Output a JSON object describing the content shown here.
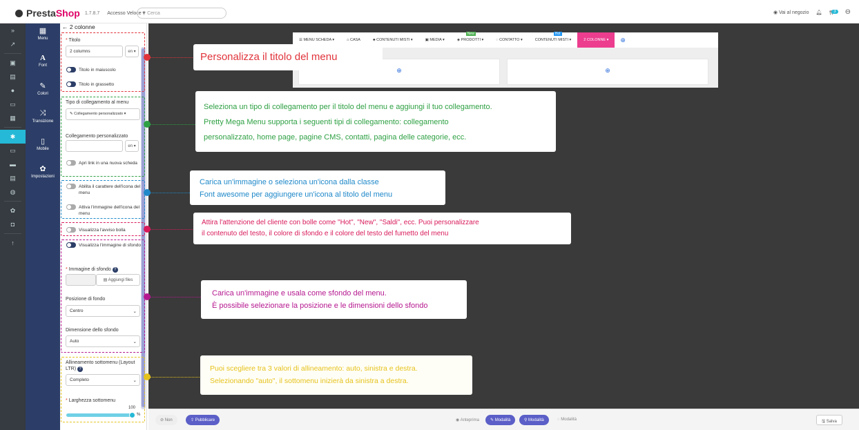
{
  "topbar": {
    "brand_prefix": "Presta",
    "brand_suffix": "Shop",
    "version": "1.7.8.7",
    "quick_access": "Accesso Veloce ▾",
    "search_placeholder": "Cerca",
    "shop_link": "Vai al negozio",
    "cart_badge": "3"
  },
  "tools": [
    {
      "icon": "▦",
      "label": "Menu"
    },
    {
      "icon": "A",
      "label": "Font"
    },
    {
      "icon": "✎",
      "label": "Colori"
    },
    {
      "icon": "⤨",
      "label": "Transizione"
    },
    {
      "icon": "▯",
      "label": "Mobile"
    },
    {
      "icon": "✿",
      "label": "Impostazioni"
    }
  ],
  "panel": {
    "back_title": "← 2 colonne",
    "title_label": "Titolo",
    "title_value": "2 columns",
    "lang": "en ▾",
    "uppercase_label": "Titolo in maiuscolo",
    "bold_label": "Titolo in grassetto",
    "link_type_label": "Tipo di collegamento al menu",
    "link_type_value": "Collegamento personalizzato ▾",
    "custom_link_label": "Collegamento personalizzato",
    "new_tab_label": "Apri link in una nuova scheda",
    "icon_char_label": "Abilita il carattere dell'icona del menu",
    "icon_image_label": "Attiva l'immagine dell'icona del menu",
    "bubble_label": "Visualizza l'avviso bolla",
    "bg_image_label": "Visualizza l'immagine di sfondo",
    "bg_image_field": "Immagine di sfondo",
    "add_files": "Aggiungi files",
    "bg_position_label": "Posizione di fondo",
    "bg_position_value": "Centro",
    "bg_size_label": "Dimensione dello sfondo",
    "bg_size_value": "Auto",
    "align_label": "Allineamento sottomenu (Layout LTR)",
    "align_value": "Completo",
    "width_label": "Larghezza sottomenu",
    "width_value": "100",
    "width_unit": "%"
  },
  "menubar": {
    "items": [
      "MENU SCHEDA ▾",
      "CASA",
      "CONTENUTI MISTI ▾",
      "MEDIA ▾",
      "PRODOTTI ▾",
      "CONTATTO ▾",
      "CONTENUTI MISTI ▾",
      "2 COLONNE ▾"
    ],
    "new_tag": "New",
    "hot_tag": "Hot"
  },
  "callouts": {
    "c1": "Personalizza il titolo del menu",
    "c2a": "Seleziona un tipo di collegamento per il titolo del menu e aggiungi il tuo collegamento.",
    "c2b": "Pretty Mega Menu supporta i seguenti tipi di collegamento: collegamento",
    "c2c": "personalizzato, home page, pagine CMS, contatti, pagina delle categorie, ecc.",
    "c3a": "Carica un'immagine o seleziona un'icona dalla classe",
    "c3b": "Font awesome per aggiungere un'icona al titolo del menu",
    "c4a": "Attira l'attenzione del cliente con bolle come \"Hot\", \"New\", \"Saldi\", ecc. Puoi personalizzare",
    "c4b": "il contenuto del testo, il colore di sfondo e il colore del testo del fumetto del menu",
    "c5a": "Carica un'immagine e usala come sfondo del menu.",
    "c5b": "È possibile selezionare la posizione e le dimensioni dello sfondo",
    "c6a": "Puoi scegliere tra 3 valori di allineamento: auto, sinistra e destra.",
    "c6b": "Selezionando \"auto\", il sottomenu inizierà da sinistra a destra."
  },
  "colors": {
    "red": "#e0333a",
    "green": "#2ea043",
    "blue": "#1e88c9",
    "magenta": "#d8195a",
    "purple": "#b5178f",
    "yellow": "#e5c21c"
  },
  "bottombar": {
    "non": "⊘ Non",
    "publish": "⇪ Pubblicare",
    "preview": "◉ Anteprima",
    "mode1": "✎ Modalità",
    "mode2": "⚲ Modalità",
    "mode3": "◌ Modalità",
    "save": "🖫 Salva"
  }
}
